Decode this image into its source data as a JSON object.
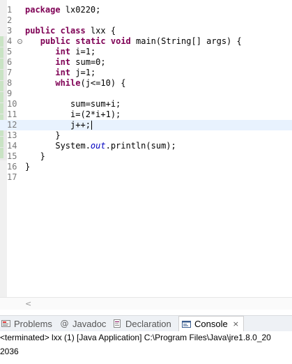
{
  "editor": {
    "lines": [
      {
        "num": "1",
        "parts": [
          [
            "kw",
            "package"
          ],
          [
            "var",
            " lx0220;"
          ]
        ]
      },
      {
        "num": "2",
        "parts": []
      },
      {
        "num": "3",
        "parts": [
          [
            "kw",
            "public"
          ],
          [
            "var",
            " "
          ],
          [
            "kw",
            "class"
          ],
          [
            "var",
            " lxx {"
          ]
        ]
      },
      {
        "num": "4",
        "fold": "-",
        "parts": [
          [
            "var",
            "   "
          ],
          [
            "kw",
            "public"
          ],
          [
            "var",
            " "
          ],
          [
            "kw",
            "static"
          ],
          [
            "var",
            " "
          ],
          [
            "kw",
            "void"
          ],
          [
            "var",
            " main(String[] args) {"
          ]
        ]
      },
      {
        "num": "5",
        "parts": [
          [
            "var",
            "      "
          ],
          [
            "kw",
            "int"
          ],
          [
            "var",
            " i=1;"
          ]
        ]
      },
      {
        "num": "6",
        "parts": [
          [
            "var",
            "      "
          ],
          [
            "kw",
            "int"
          ],
          [
            "var",
            " sum=0;"
          ]
        ]
      },
      {
        "num": "7",
        "parts": [
          [
            "var",
            "      "
          ],
          [
            "kw",
            "int"
          ],
          [
            "var",
            " j=1;"
          ]
        ]
      },
      {
        "num": "8",
        "parts": [
          [
            "var",
            "      "
          ],
          [
            "kw",
            "while"
          ],
          [
            "var",
            "(j<=10) {"
          ]
        ]
      },
      {
        "num": "9",
        "parts": []
      },
      {
        "num": "10",
        "parts": [
          [
            "var",
            "         sum=sum+i;"
          ]
        ]
      },
      {
        "num": "11",
        "parts": [
          [
            "var",
            "         i=(2*i+1);"
          ]
        ]
      },
      {
        "num": "12",
        "current": true,
        "parts": [
          [
            "var",
            "         j++;"
          ]
        ]
      },
      {
        "num": "13",
        "parts": [
          [
            "var",
            "      }"
          ]
        ]
      },
      {
        "num": "14",
        "parts": [
          [
            "var",
            "      System."
          ],
          [
            "fld",
            "out"
          ],
          [
            "var",
            ".println(sum);"
          ]
        ]
      },
      {
        "num": "15",
        "parts": [
          [
            "var",
            "   }"
          ]
        ]
      },
      {
        "num": "16",
        "parts": [
          [
            "var",
            "}"
          ]
        ]
      },
      {
        "num": "17",
        "parts": []
      }
    ]
  },
  "views": {
    "tabs": [
      {
        "label": "Problems",
        "icon": "problems-icon"
      },
      {
        "label": "Javadoc",
        "icon": "javadoc-icon"
      },
      {
        "label": "Declaration",
        "icon": "declaration-icon"
      },
      {
        "label": "Console",
        "icon": "console-icon",
        "active": true
      }
    ],
    "close_glyph": "×",
    "console_header": "<terminated> lxx (1) [Java Application] C:\\Program Files\\Java\\jre1.8.0_20",
    "console_output": "2036"
  },
  "colors": {
    "keyword": "#7f0055",
    "field": "#0000c0",
    "current_line": "#e8f2fe",
    "line_number": "#787878"
  }
}
